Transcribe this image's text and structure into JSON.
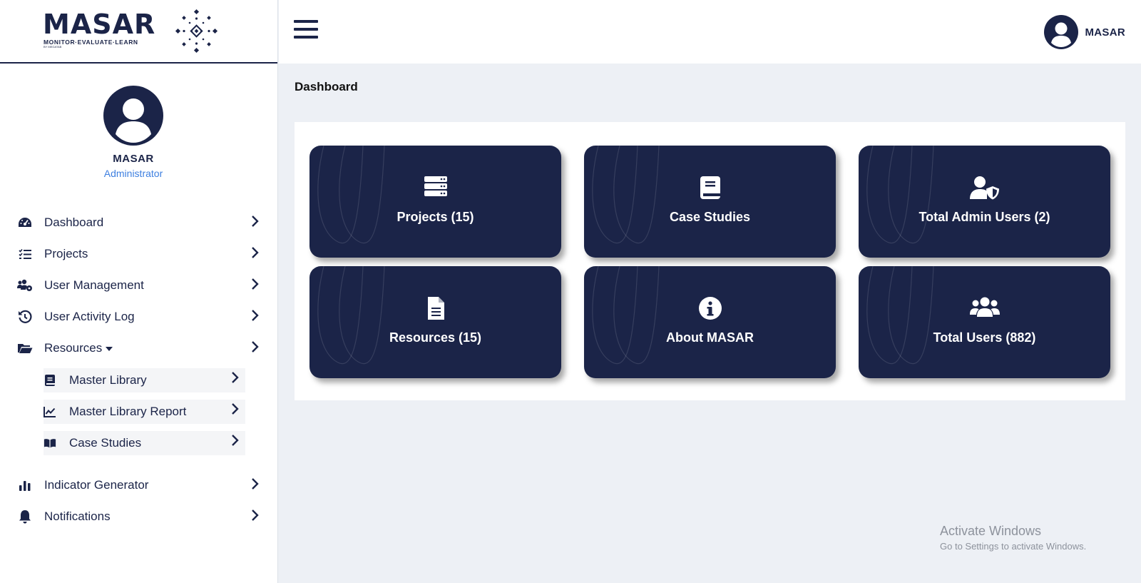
{
  "brand": {
    "name": "MASAR",
    "tagline": "MONITOR·EVALUATE·LEARN",
    "by_line": "BY MEGATAB"
  },
  "profile": {
    "name": "MASAR",
    "role": "Administrator",
    "avatar_icon": "user-circle-icon"
  },
  "sidebar": {
    "items": [
      {
        "label": "Dashboard",
        "icon": "speedometer-icon"
      },
      {
        "label": "Projects",
        "icon": "task-list-icon"
      },
      {
        "label": "User Management",
        "icon": "users-cog-icon"
      },
      {
        "label": "User Activity Log",
        "icon": "history-icon"
      },
      {
        "label": "Resources",
        "icon": "folder-open-icon",
        "expanded": true
      },
      {
        "label": "Indicator Generator",
        "icon": "bar-chart-icon"
      },
      {
        "label": "Notifications",
        "icon": "bell-icon"
      }
    ],
    "sub_items": [
      {
        "label": "Master Library",
        "icon": "book-icon"
      },
      {
        "label": "Master Library Report",
        "icon": "line-chart-icon"
      },
      {
        "label": "Case Studies",
        "icon": "book-open-icon"
      }
    ]
  },
  "topbar": {
    "menu_icon": "hamburger-icon",
    "user_name": "MASAR"
  },
  "main": {
    "title": "Dashboard",
    "cards": [
      {
        "label": "Projects (15)",
        "icon": "server-icon"
      },
      {
        "label": "Case Studies",
        "icon": "book-icon"
      },
      {
        "label": "Total Admin Users (2)",
        "icon": "user-shield-icon"
      },
      {
        "label": "Resources (15)",
        "icon": "file-text-icon"
      },
      {
        "label": "About MASAR",
        "icon": "info-circle-icon"
      },
      {
        "label": "Total Users (882)",
        "icon": "users-icon"
      }
    ]
  },
  "watermark": {
    "line1": "Activate Windows",
    "line2": "Go to Settings to activate Windows."
  },
  "colors": {
    "navy": "#1b2448",
    "accent": "#3d7fe0",
    "background": "#edf0f5"
  }
}
